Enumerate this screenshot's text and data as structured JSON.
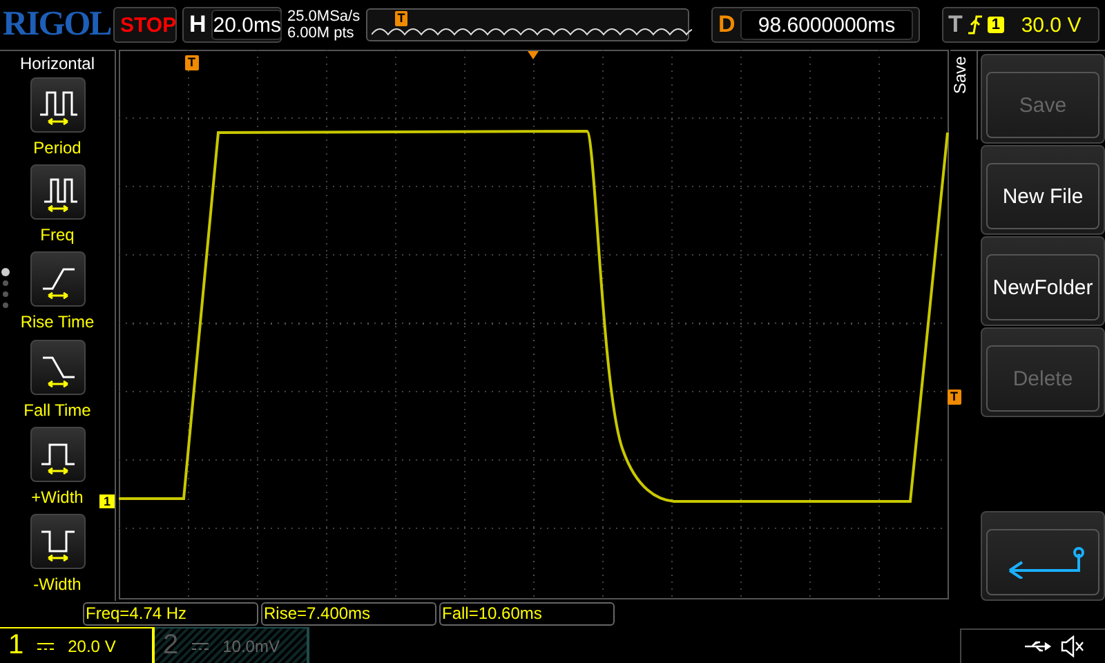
{
  "logo": "RIGOL",
  "run_state": "STOP",
  "horizontal": {
    "label": "H",
    "timebase": "20.0ms"
  },
  "acquisition": {
    "sample_rate": "25.0MSa/s",
    "memory_depth": "6.00M pts"
  },
  "memory_marker": "T",
  "delay": {
    "label": "D",
    "value": "98.6000000ms"
  },
  "trigger": {
    "label": "T",
    "source": "1",
    "level_reading": "30.0 V"
  },
  "measure_menu": {
    "title": "Horizontal",
    "items": [
      {
        "kind": "period",
        "label": "Period"
      },
      {
        "kind": "freq",
        "label": "Freq"
      },
      {
        "kind": "rise",
        "label": "Rise Time"
      },
      {
        "kind": "fall",
        "label": "Fall Time"
      },
      {
        "kind": "pwidth",
        "label": "+Width"
      },
      {
        "kind": "nwidth",
        "label": "-Width"
      }
    ]
  },
  "grid_markers": {
    "trigger_time": "T",
    "trigger_level": "T",
    "channel": "1"
  },
  "save_menu": {
    "title": "Save",
    "buttons": [
      {
        "label": "Save",
        "disabled": true
      },
      {
        "label": "New File",
        "disabled": false
      },
      {
        "label": "NewFolder",
        "disabled": false
      },
      {
        "label": "Delete",
        "disabled": true
      }
    ]
  },
  "measurements": [
    "Freq=4.74 Hz",
    "Rise=7.400ms",
    "Fall=10.60ms"
  ],
  "channels": [
    {
      "number": "1",
      "scale": "20.0 V",
      "selected": true
    },
    {
      "number": "2",
      "scale": "10.0mV",
      "selected": false
    }
  ]
}
